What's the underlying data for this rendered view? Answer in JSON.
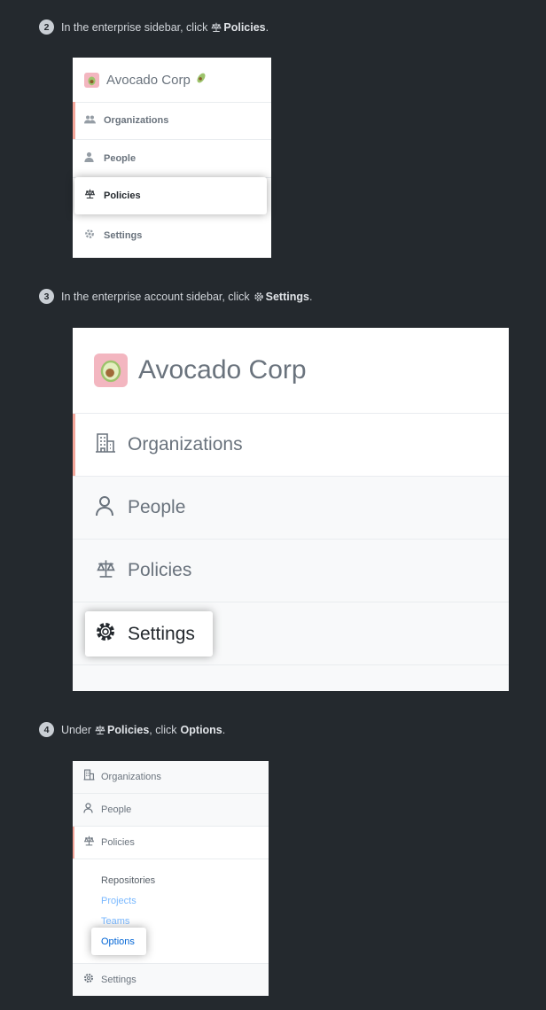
{
  "step2": {
    "number": "2",
    "text_before": "In the enterprise sidebar, click",
    "bold": "Policies",
    "text_after": ".",
    "panel": {
      "title": "Avocado Corp",
      "items": [
        "Organizations",
        "People",
        "Policies",
        "Settings"
      ]
    }
  },
  "step3": {
    "number": "3",
    "text_before": "In the enterprise account sidebar, click",
    "bold": "Settings",
    "text_after": ".",
    "panel": {
      "title": "Avocado Corp",
      "items": [
        "Organizations",
        "People",
        "Policies",
        "Settings"
      ]
    }
  },
  "step4": {
    "number": "4",
    "text_before": "Under",
    "bold1": "Policies",
    "text_middle": ", click",
    "bold2": "Options",
    "text_after": ".",
    "panel": {
      "items": [
        "Organizations",
        "People",
        "Policies",
        "Settings"
      ],
      "sub_items": [
        "Repositories",
        "Projects",
        "Teams",
        "Options"
      ]
    }
  },
  "colors": {
    "background": "#24292e",
    "accent": "#f4a69a",
    "link": "#0366d6"
  }
}
